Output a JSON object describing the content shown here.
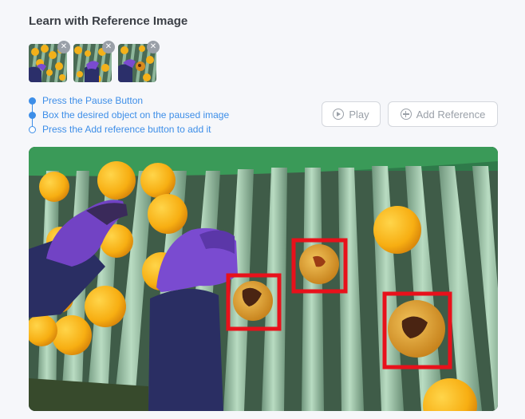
{
  "panel": {
    "title": "Learn with Reference Image"
  },
  "references": [
    {
      "name": "reference-1",
      "remove_symbol": "✕"
    },
    {
      "name": "reference-2",
      "remove_symbol": "✕"
    },
    {
      "name": "reference-3",
      "remove_symbol": "✕"
    }
  ],
  "steps": [
    {
      "label": "Press the Pause Button",
      "state": "done"
    },
    {
      "label": "Box the desired object on the paused image",
      "state": "done"
    },
    {
      "label": "Press the Add reference button to add it",
      "state": "pending"
    }
  ],
  "controls": {
    "play_label": "Play",
    "add_reference_label": "Add Reference"
  },
  "colors": {
    "accent": "#3d8ee8",
    "box": "#e8111b",
    "button_text": "#9aa0a8"
  },
  "icons": {
    "play": "play-circle-icon",
    "add": "plus-circle-icon",
    "remove": "close-icon"
  }
}
